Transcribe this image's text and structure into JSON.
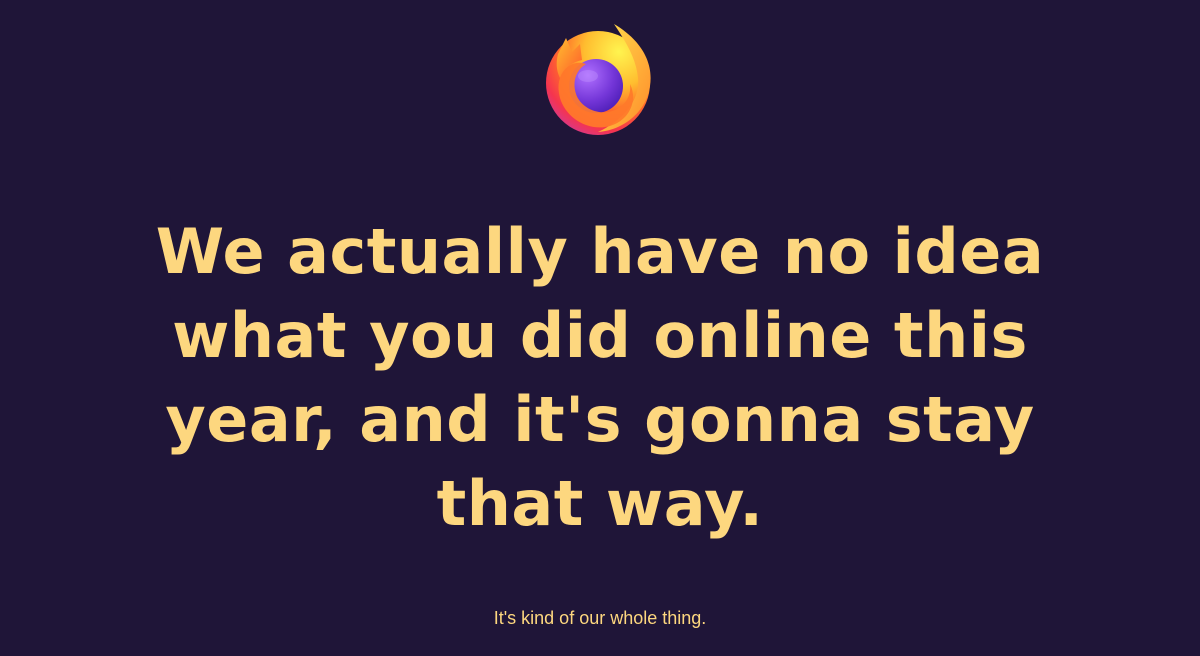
{
  "logo": {
    "icon": "firefox-logo-icon"
  },
  "headline": "We actually have no idea what you did online this year, and it's gonna stay that way.",
  "tagline": "It's kind of our whole thing.",
  "colors": {
    "background": "#1f1538",
    "text": "#fdd77f"
  }
}
